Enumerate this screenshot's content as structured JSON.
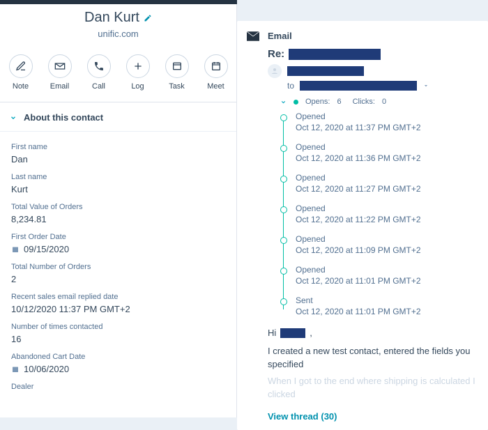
{
  "contact": {
    "name": "Dan Kurt",
    "domain": "unific.com"
  },
  "actions": {
    "note": "Note",
    "email": "Email",
    "call": "Call",
    "log": "Log",
    "task": "Task",
    "meet": "Meet"
  },
  "about": {
    "header": "About this contact",
    "props": {
      "first_name_label": "First name",
      "first_name_value": "Dan",
      "last_name_label": "Last name",
      "last_name_value": "Kurt",
      "tvo_label": "Total Value of Orders",
      "tvo_value": "8,234.81",
      "fod_label": "First Order Date",
      "fod_value": "09/15/2020",
      "tno_label": "Total Number of Orders",
      "tno_value": "2",
      "rser_label": "Recent sales email replied date",
      "rser_value": "10/12/2020 11:37 PM GMT+2",
      "ntc_label": "Number of times contacted",
      "ntc_value": "16",
      "acd_label": "Abandoned Cart Date",
      "acd_value": "10/06/2020",
      "dealer_label": "Dealer"
    }
  },
  "email": {
    "title": "Email",
    "subject_prefix": "Re:",
    "to_label": "to",
    "opens_label": "Opens:",
    "opens_count": "6",
    "clicks_label": "Clicks:",
    "clicks_count": "0",
    "events": [
      {
        "type": "Opened",
        "time": "Oct 12, 2020 at 11:37 PM GMT+2"
      },
      {
        "type": "Opened",
        "time": "Oct 12, 2020 at 11:36 PM GMT+2"
      },
      {
        "type": "Opened",
        "time": "Oct 12, 2020 at 11:27 PM GMT+2"
      },
      {
        "type": "Opened",
        "time": "Oct 12, 2020 at 11:22 PM GMT+2"
      },
      {
        "type": "Opened",
        "time": "Oct 12, 2020 at 11:09 PM GMT+2"
      },
      {
        "type": "Opened",
        "time": "Oct 12, 2020 at 11:01 PM GMT+2"
      },
      {
        "type": "Sent",
        "time": "Oct 12, 2020 at 11:01 PM GMT+2"
      }
    ],
    "body_greeting": "Hi",
    "body_greeting_punct": ",",
    "body_line1": "I created a new test contact, entered the fields you specified",
    "body_line2_faded": "When I got to the end where shipping is calculated I clicked",
    "view_thread_label": "View thread",
    "view_thread_count": "(30)"
  }
}
